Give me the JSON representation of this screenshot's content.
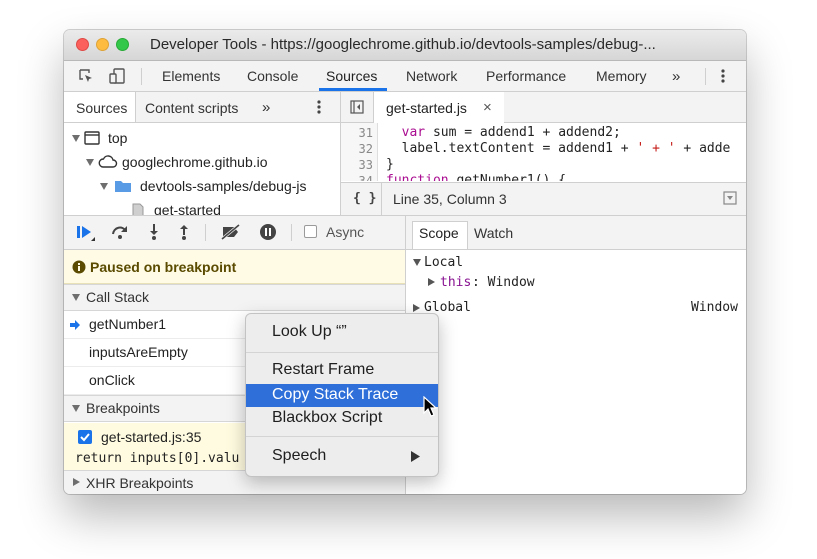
{
  "window": {
    "title": "Developer Tools - https://googlechrome.github.io/devtools-samples/debug-..."
  },
  "main_tabs": [
    {
      "label": "Elements"
    },
    {
      "label": "Console"
    },
    {
      "label": "Sources"
    },
    {
      "label": "Network"
    },
    {
      "label": "Performance"
    },
    {
      "label": "Memory"
    }
  ],
  "more_tabs": "»",
  "navigator": {
    "tabs": [
      {
        "label": "Sources"
      },
      {
        "label": "Content scripts"
      }
    ],
    "more": "»",
    "tree": [
      {
        "label": "top"
      },
      {
        "label": "googlechrome.github.io"
      },
      {
        "label": "devtools-samples/debug-js"
      },
      {
        "label": "get-started"
      }
    ]
  },
  "editor": {
    "file_tab": "get-started.js",
    "close_glyph": "×",
    "line_numbers": [
      "31",
      "32",
      "33",
      "34"
    ],
    "lines": {
      "l31": "  var sum = addend1 + addend2;",
      "l32a": "  label.textContent = addend1 + ",
      "l32s1": "' + '",
      "l32b": " + adde",
      "l33": "}",
      "l34kw": "function",
      "l34": " getNumber1() {"
    },
    "format_label": "{ }",
    "cursor_position": "Line 35, Column 3"
  },
  "debugger": {
    "async_label": "Async",
    "paused_message": "Paused on breakpoint",
    "call_stack_header": "Call Stack",
    "call_stack": [
      {
        "label": "getNumber1"
      },
      {
        "label": "inputsAreEmpty"
      },
      {
        "label": "onClick"
      }
    ],
    "breakpoints_header": "Breakpoints",
    "breakpoint": {
      "file": "get-started.js:35",
      "code": "return inputs[0].valu"
    },
    "xhr_header": "XHR Breakpoints"
  },
  "scope": {
    "tabs": [
      {
        "label": "Scope"
      },
      {
        "label": "Watch"
      }
    ],
    "local_label": "Local",
    "this_key": "this",
    "this_value": ": Window",
    "global_label": "Global",
    "global_value": "Window"
  },
  "context_menu": {
    "items": [
      {
        "label": "Look Up “”"
      },
      {
        "label": "Restart Frame"
      },
      {
        "label": "Copy Stack Trace"
      },
      {
        "label": "Blackbox Script"
      },
      {
        "label": "Speech"
      }
    ]
  },
  "colors": {
    "accent": "#1a73e8",
    "menu_highlight": "#2f6fd9",
    "paused_bg": "#fffbe5"
  }
}
